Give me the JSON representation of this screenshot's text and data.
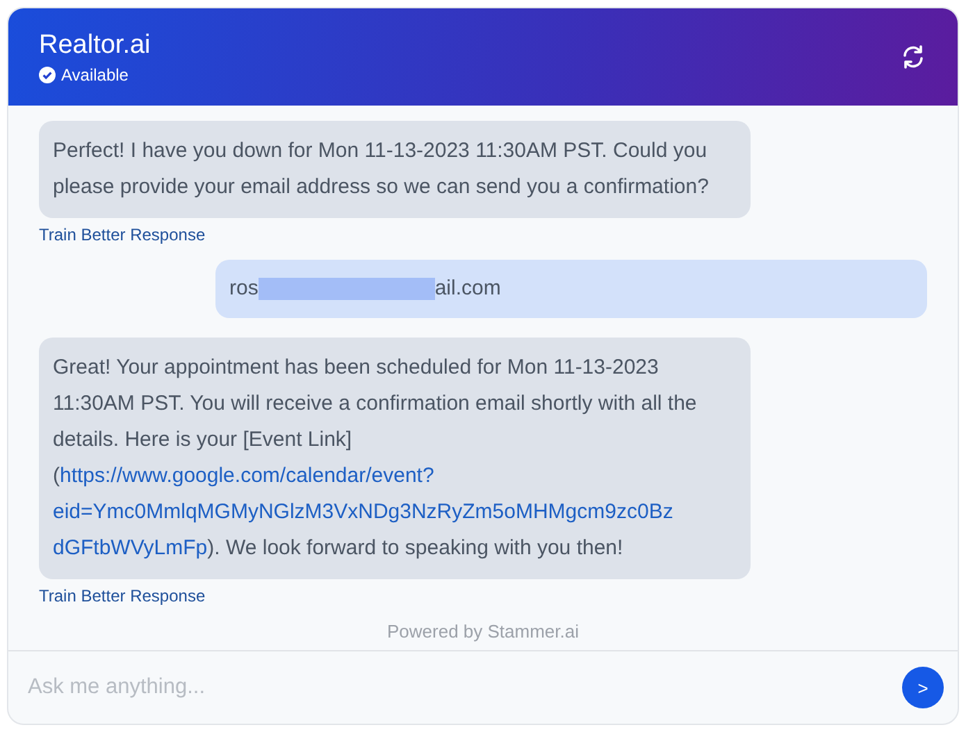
{
  "header": {
    "title": "Realtor.ai",
    "status": "Available",
    "available": true
  },
  "messages": [
    {
      "kind": "bot",
      "segments": [
        {
          "kind": "text",
          "text": "Perfect! I have you down for Mon 11-13-2023 11:30AM PST. Could you please provide your email address so we can send you a confirmation?"
        }
      ],
      "action": "Train Better Response"
    },
    {
      "kind": "user",
      "text_before": "ros",
      "redacted": true,
      "text_after": "ail.com"
    },
    {
      "kind": "bot",
      "segments": [
        {
          "kind": "text",
          "text": "Great! Your appointment has been scheduled for Mon 11-13-2023 11:30AM PST. You will receive a confirmation email shortly with all the details. Here is your [Event Link] ("
        },
        {
          "kind": "link",
          "text": "https://www.google.com/calendar/event?"
        },
        {
          "kind": "link",
          "text": "eid=Ymc0MmlqMGMyNGlzM3VxNDg3NzRyZm5oMHMgcm9zc0Bz"
        },
        {
          "kind": "link",
          "text": "dGFtbWVyLmFp"
        },
        {
          "kind": "text",
          "text": "). We look forward to speaking with you then!"
        }
      ],
      "action": "Train Better Response"
    }
  ],
  "footer": {
    "powered_by": "Powered by Stammer.ai",
    "input": {
      "placeholder": "Ask me anything..."
    },
    "send": ">"
  }
}
